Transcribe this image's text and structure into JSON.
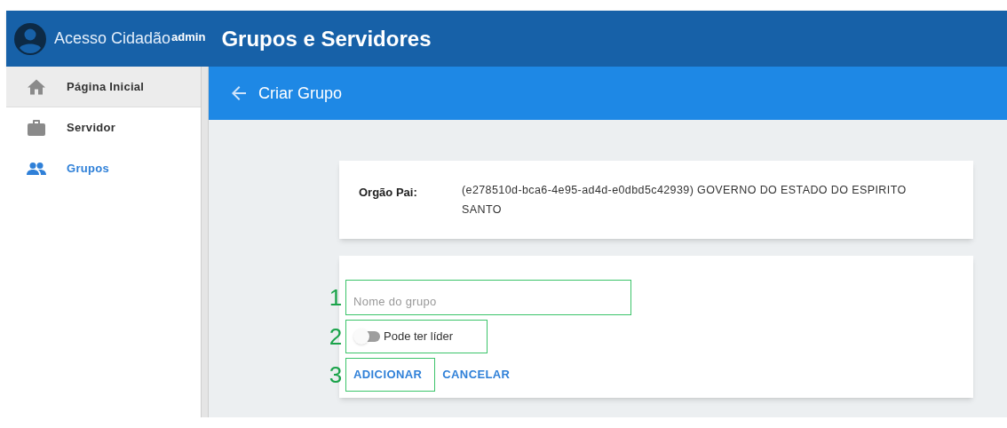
{
  "header": {
    "brand": "Acesso Cidadão",
    "brand_badge": "admin",
    "title": "Grupos e Servidores"
  },
  "sidebar": {
    "items": [
      {
        "label": "Página Inicial",
        "kind": "home",
        "selected": false,
        "hovered": true
      },
      {
        "label": "Servidor",
        "kind": "briefcase",
        "selected": false,
        "hovered": false
      },
      {
        "label": "Grupos",
        "kind": "people",
        "selected": true,
        "hovered": false
      }
    ]
  },
  "page_bar": {
    "title": "Criar Grupo"
  },
  "parent_card": {
    "label": "Orgão Pai:",
    "value": "(e278510d-bca6-4e95-ad4d-e0dbd5c42939) GOVERNO DO ESTADO DO ESPIRITO SANTO"
  },
  "form": {
    "name_field": {
      "placeholder": "Nome do grupo",
      "marker": "1"
    },
    "leader_switch": {
      "label": "Pode ter líder",
      "on": false,
      "marker": "2"
    },
    "buttons": [
      {
        "label": "ADICIONAR",
        "marker": "3"
      },
      {
        "label": "CANCELAR"
      }
    ]
  }
}
